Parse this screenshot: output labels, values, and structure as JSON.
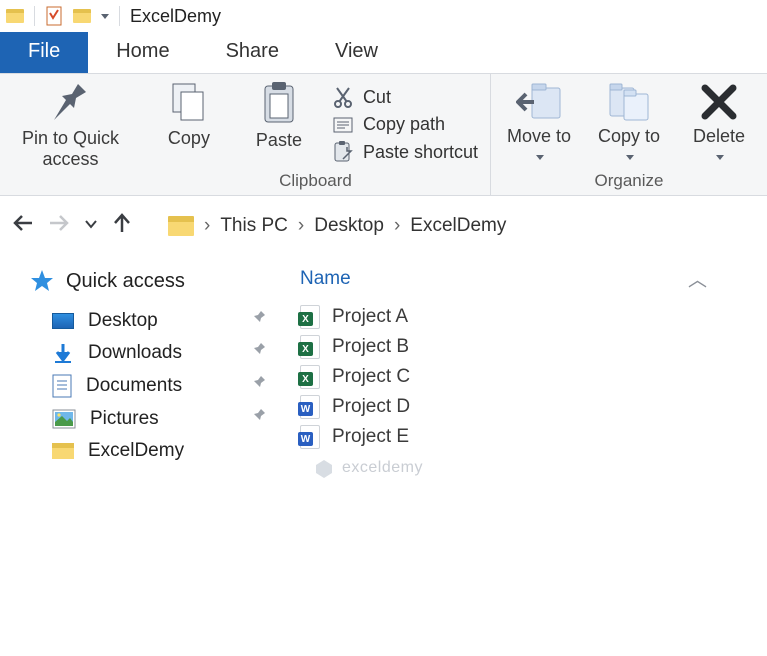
{
  "title": "ExcelDemy",
  "tabs": {
    "file": "File",
    "home": "Home",
    "share": "Share",
    "view": "View"
  },
  "ribbon": {
    "pin": "Pin to Quick access",
    "copy_btn": "Copy",
    "paste_btn": "Paste",
    "cut": "Cut",
    "copy_path": "Copy path",
    "paste_shortcut": "Paste shortcut",
    "clipboard_label": "Clipboard",
    "move_to": "Move to",
    "copy_to": "Copy to",
    "delete": "Delete",
    "organize_label": "Organize"
  },
  "breadcrumb": [
    "This PC",
    "Desktop",
    "ExcelDemy"
  ],
  "sidebar": {
    "quick_access": "Quick access",
    "items": [
      {
        "label": "Desktop",
        "icon": "desktop",
        "pinned": true
      },
      {
        "label": "Downloads",
        "icon": "download",
        "pinned": true
      },
      {
        "label": "Documents",
        "icon": "document",
        "pinned": true
      },
      {
        "label": "Pictures",
        "icon": "pictures",
        "pinned": true
      },
      {
        "label": "ExcelDemy",
        "icon": "folder",
        "pinned": false
      }
    ]
  },
  "list": {
    "header": "Name",
    "files": [
      {
        "name": "Project A",
        "type": "excel"
      },
      {
        "name": "Project B",
        "type": "excel"
      },
      {
        "name": "Project C",
        "type": "excel"
      },
      {
        "name": "Project D",
        "type": "word"
      },
      {
        "name": "Project E",
        "type": "word"
      }
    ]
  },
  "watermark": "exceldemy"
}
